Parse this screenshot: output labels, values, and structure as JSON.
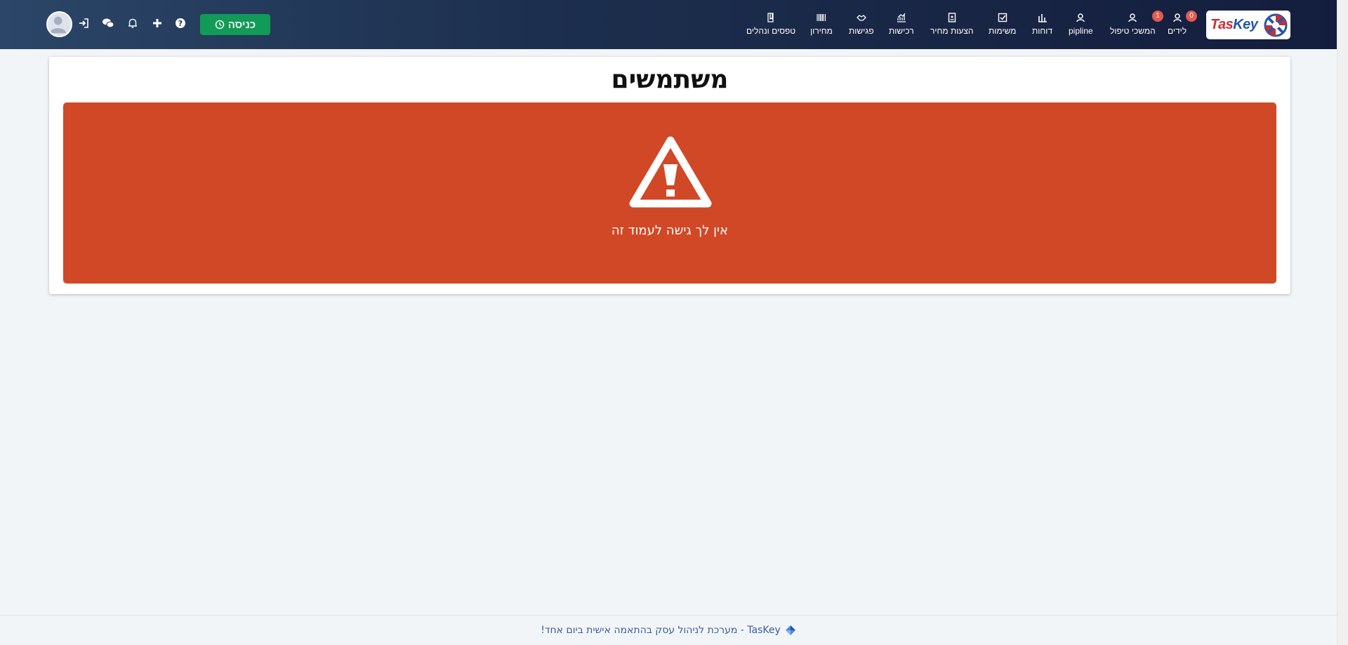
{
  "brand": {
    "logo_part1": "Tas",
    "logo_part2": "Key"
  },
  "nav": {
    "items": [
      {
        "label": "לידים",
        "icon": "users-icon",
        "badge": "0"
      },
      {
        "label": "המשכי טיפול",
        "icon": "users-icon",
        "badge": "1"
      },
      {
        "label": "pipline",
        "icon": "users-icon"
      },
      {
        "label": "דוחות",
        "icon": "chart-icon"
      },
      {
        "label": "משימות",
        "icon": "checkbox-icon"
      },
      {
        "label": "הצעות מחיר",
        "icon": "document-icon"
      },
      {
        "label": "רכישות",
        "icon": "growth-chart-icon"
      },
      {
        "label": "פגישות",
        "icon": "handshake-icon"
      },
      {
        "label": "מחירון",
        "icon": "barcode-icon"
      },
      {
        "label": "טפסים ונהלים",
        "icon": "book-icon"
      }
    ]
  },
  "toolbar": {
    "checkin_label": "כניסה",
    "icons": [
      "help-icon",
      "plus-icon",
      "bell-icon",
      "chat-icon",
      "login-icon"
    ]
  },
  "page": {
    "title": "משתמשים",
    "alert_message": "אין לך גישה לעמוד זה"
  },
  "footer": {
    "text": "TasKey - מערכת לניהול עסק בהתאמה אישית ביום אחד!"
  },
  "colors": {
    "alert_bg": "#d14826",
    "checkin_bg": "#129a58",
    "badge": "#e35a52",
    "footer_text": "#3d5c99"
  }
}
